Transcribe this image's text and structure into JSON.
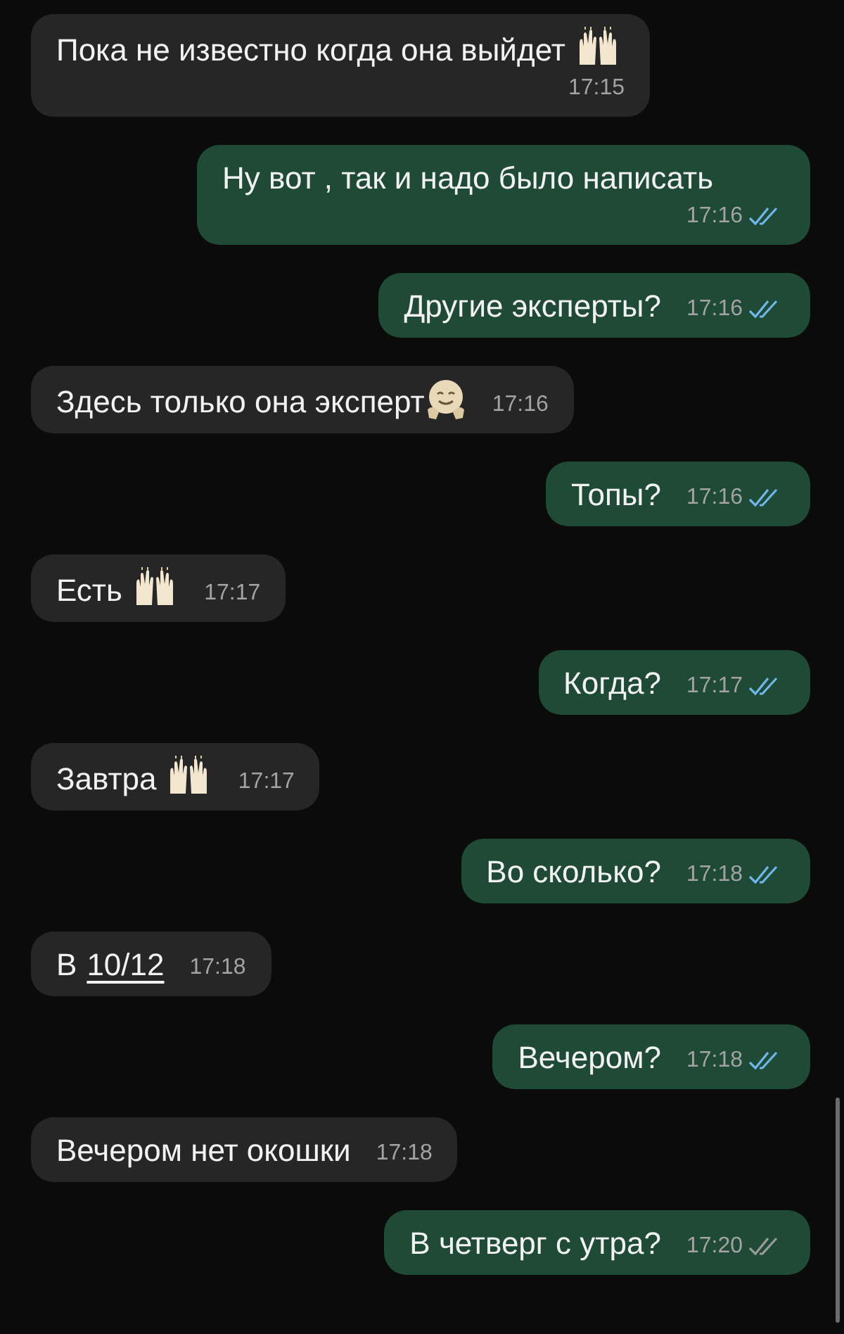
{
  "messages": [
    {
      "outgoing": false,
      "kind": "raised_hands",
      "text": "Пока не известно когда она выйдет",
      "time": "17:15"
    },
    {
      "outgoing": true,
      "kind": "plain",
      "text": "Ну вот , так и надо было написать",
      "time": "17:16",
      "read": true
    },
    {
      "outgoing": true,
      "kind": "plain",
      "text": "Другие эксперты?",
      "time": "17:16",
      "read": true
    },
    {
      "outgoing": false,
      "kind": "hug",
      "text": "Здесь только она эксперт",
      "time": "17:16"
    },
    {
      "outgoing": true,
      "kind": "plain",
      "text": "Топы?",
      "time": "17:16",
      "read": true
    },
    {
      "outgoing": false,
      "kind": "raised_hands",
      "text": "Есть",
      "time": "17:17"
    },
    {
      "outgoing": true,
      "kind": "plain",
      "text": "Когда?",
      "time": "17:17",
      "read": true
    },
    {
      "outgoing": false,
      "kind": "raised_hands",
      "text": "Завтра",
      "time": "17:17"
    },
    {
      "outgoing": true,
      "kind": "plain",
      "text": "Во сколько?",
      "time": "17:18",
      "read": true
    },
    {
      "outgoing": false,
      "kind": "link",
      "text": "В",
      "link": "10/12",
      "time": "17:18"
    },
    {
      "outgoing": true,
      "kind": "plain",
      "text": "Вечером?",
      "time": "17:18",
      "read": true
    },
    {
      "outgoing": false,
      "kind": "plain",
      "text": "Вечером нет окошки",
      "time": "17:18"
    },
    {
      "outgoing": true,
      "kind": "plain",
      "text": "В четверг с утра?",
      "time": "17:20",
      "read": false
    }
  ]
}
